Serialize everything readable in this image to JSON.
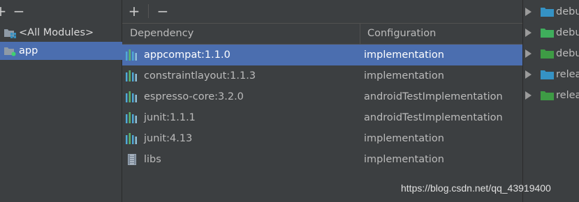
{
  "left_toolbar": {
    "remove_label": "−"
  },
  "modules": [
    {
      "label": "<All Modules>",
      "icon": "all-modules-icon",
      "selected": false
    },
    {
      "label": "app",
      "icon": "module-folder-icon",
      "selected": true
    }
  ],
  "mid_toolbar": {
    "add_label": "+",
    "remove_label": "−"
  },
  "table": {
    "columns": [
      "Dependency",
      "Configuration"
    ],
    "rows": [
      {
        "dependency": "appcompat:1.1.0",
        "configuration": "implementation",
        "icon": "library-bars-icon",
        "selected": true
      },
      {
        "dependency": "constraintlayout:1.1.3",
        "configuration": "implementation",
        "icon": "library-bars-icon",
        "selected": false
      },
      {
        "dependency": "espresso-core:3.2.0",
        "configuration": "androidTestImplementation",
        "icon": "library-bars-icon",
        "selected": false
      },
      {
        "dependency": "junit:1.1.1",
        "configuration": "androidTestImplementation",
        "icon": "library-bars-icon",
        "selected": false
      },
      {
        "dependency": "junit:4.13",
        "configuration": "implementation",
        "icon": "library-bars-icon",
        "selected": false
      },
      {
        "dependency": "libs",
        "configuration": "implementation",
        "icon": "jar-icon",
        "selected": false
      }
    ]
  },
  "variants": [
    {
      "label": "debu",
      "color": "#3592c4"
    },
    {
      "label": "debu",
      "color": "#3fae5c"
    },
    {
      "label": "debu",
      "color": "#3e9b45"
    },
    {
      "label": "relea",
      "color": "#3592c4"
    },
    {
      "label": "relea",
      "color": "#3e9b45"
    }
  ],
  "watermark": "https://blog.csdn.net/qq_43919400",
  "colors": {
    "selection": "#4b6eaf",
    "panel": "#3c3f41"
  }
}
